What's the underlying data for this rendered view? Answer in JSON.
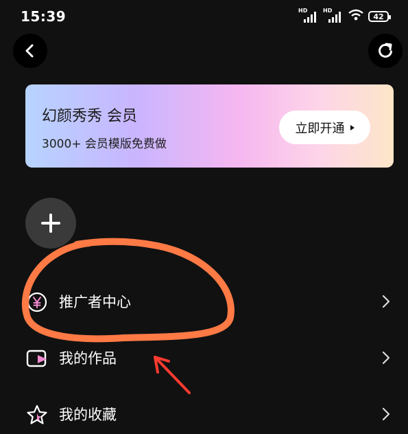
{
  "status_bar": {
    "time": "15:39",
    "network_1": "HD",
    "network_2": "HD",
    "battery": "42"
  },
  "header": {
    "back_icon": "chevron-left-icon",
    "refresh_icon": "refresh-icon"
  },
  "vip_banner": {
    "title": "幻颜秀秀 会员",
    "subtitle": "3000+ 会员模版免费做",
    "button_label": "立即开通",
    "colors": [
      "#b7d4ff",
      "#c9b5ff",
      "#f6b7f0",
      "#fde6c8"
    ]
  },
  "add_button": {
    "icon": "plus-icon"
  },
  "menu": {
    "items": [
      {
        "label": "推广者中心",
        "icon": "yen-coin-icon"
      },
      {
        "label": "我的作品",
        "icon": "video-play-icon"
      },
      {
        "label": "我的收藏",
        "icon": "star-icon"
      }
    ]
  },
  "annotation": {
    "color": "#ff7a45",
    "arrow_color": "#ff3b30"
  }
}
